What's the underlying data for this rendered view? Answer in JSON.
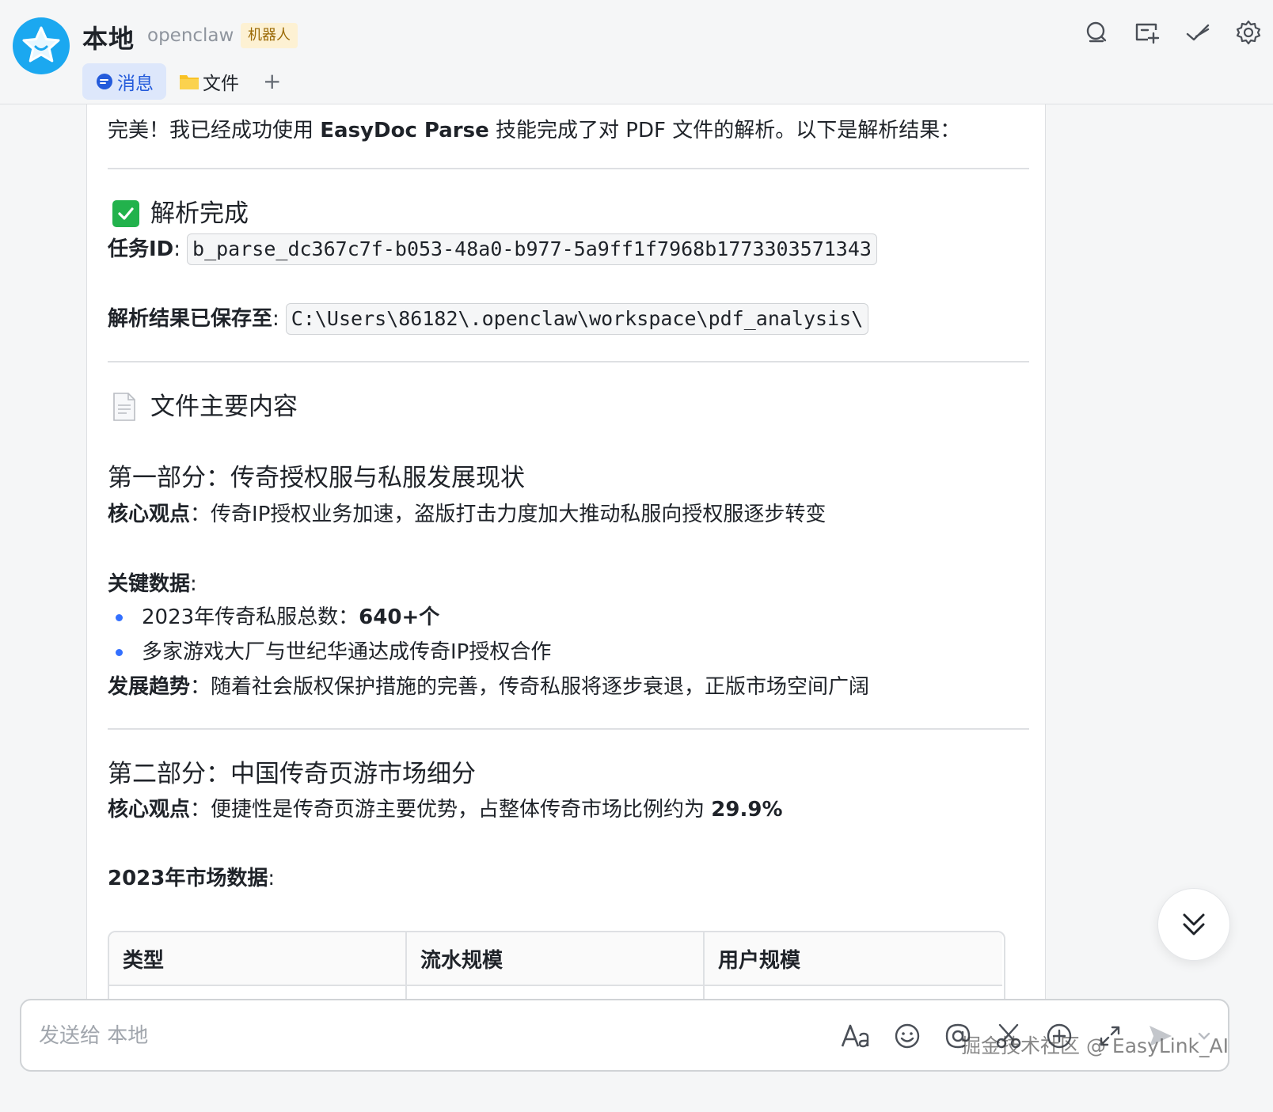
{
  "header": {
    "title": "本地",
    "subtitle": "openclaw",
    "badge": "机器人",
    "icons": [
      "search-chat-icon",
      "add-screen-icon",
      "done-check-icon",
      "settings-gear-icon"
    ]
  },
  "tabs": [
    {
      "label": "消息",
      "icon": "message-bubble-icon",
      "active": true
    },
    {
      "label": "文件",
      "icon": "folder-icon",
      "active": false
    }
  ],
  "tab_add": "+",
  "message": {
    "intro_pre": "完美！我已经成功使用 ",
    "intro_bold": "EasyDoc Parse",
    "intro_post": " 技能完成了对 PDF 文件的解析。以下是解析结果：",
    "done_heading": "解析完成",
    "task_id_label": "任务ID",
    "task_id_value": "b_parse_dc367c7f-b053-48a0-b977-5a9ff1f7968b1773303571343",
    "saved_label": "解析结果已保存至",
    "saved_value": "C:\\Users\\86182\\.openclaw\\workspace\\pdf_analysis\\",
    "file_heading": "文件主要内容",
    "sections": [
      {
        "title": "第一部分：传奇授权服与私服发展现状",
        "core_label": "核心观点",
        "core_text": "传奇IP授权业务加速，盗版打击力度加大推动私服向授权服逐步转变",
        "key_label": "关键数据",
        "bullets": [
          {
            "text": "2023年传奇私服总数：",
            "bold": "640+个"
          },
          {
            "text": "多家游戏大厂与世纪华通达成传奇IP授权合作",
            "bold": ""
          }
        ],
        "trend_label": "发展趋势",
        "trend_text": "随着社会版权保护措施的完善，传奇私服将逐步衰退，正版市场空间广阔"
      },
      {
        "title": "第二部分：中国传奇页游市场细分",
        "core_label": "核心观点",
        "core_text": "便捷性是传奇页游主要优势，占整体传奇市场比例约为 ",
        "core_bold": "29.9%",
        "market_label": "2023年市场数据",
        "table_headers": [
          "类型",
          "流水规模",
          "用户规模"
        ]
      }
    ]
  },
  "composer": {
    "placeholder": "发送给 本地",
    "tools": [
      "font-format-icon",
      "emoji-icon",
      "mention-icon",
      "scissors-icon",
      "plus-circle-icon",
      "expand-icon",
      "send-icon",
      "chevron-down-icon"
    ]
  },
  "watermark": "掘金技术社区 @ EasyLink_AI",
  "colors": {
    "accent": "#245bdb",
    "avatar": "#1ba8f0",
    "check": "#22b24c",
    "bullet": "#3370ff",
    "badge_bg": "#fdf1d3"
  }
}
